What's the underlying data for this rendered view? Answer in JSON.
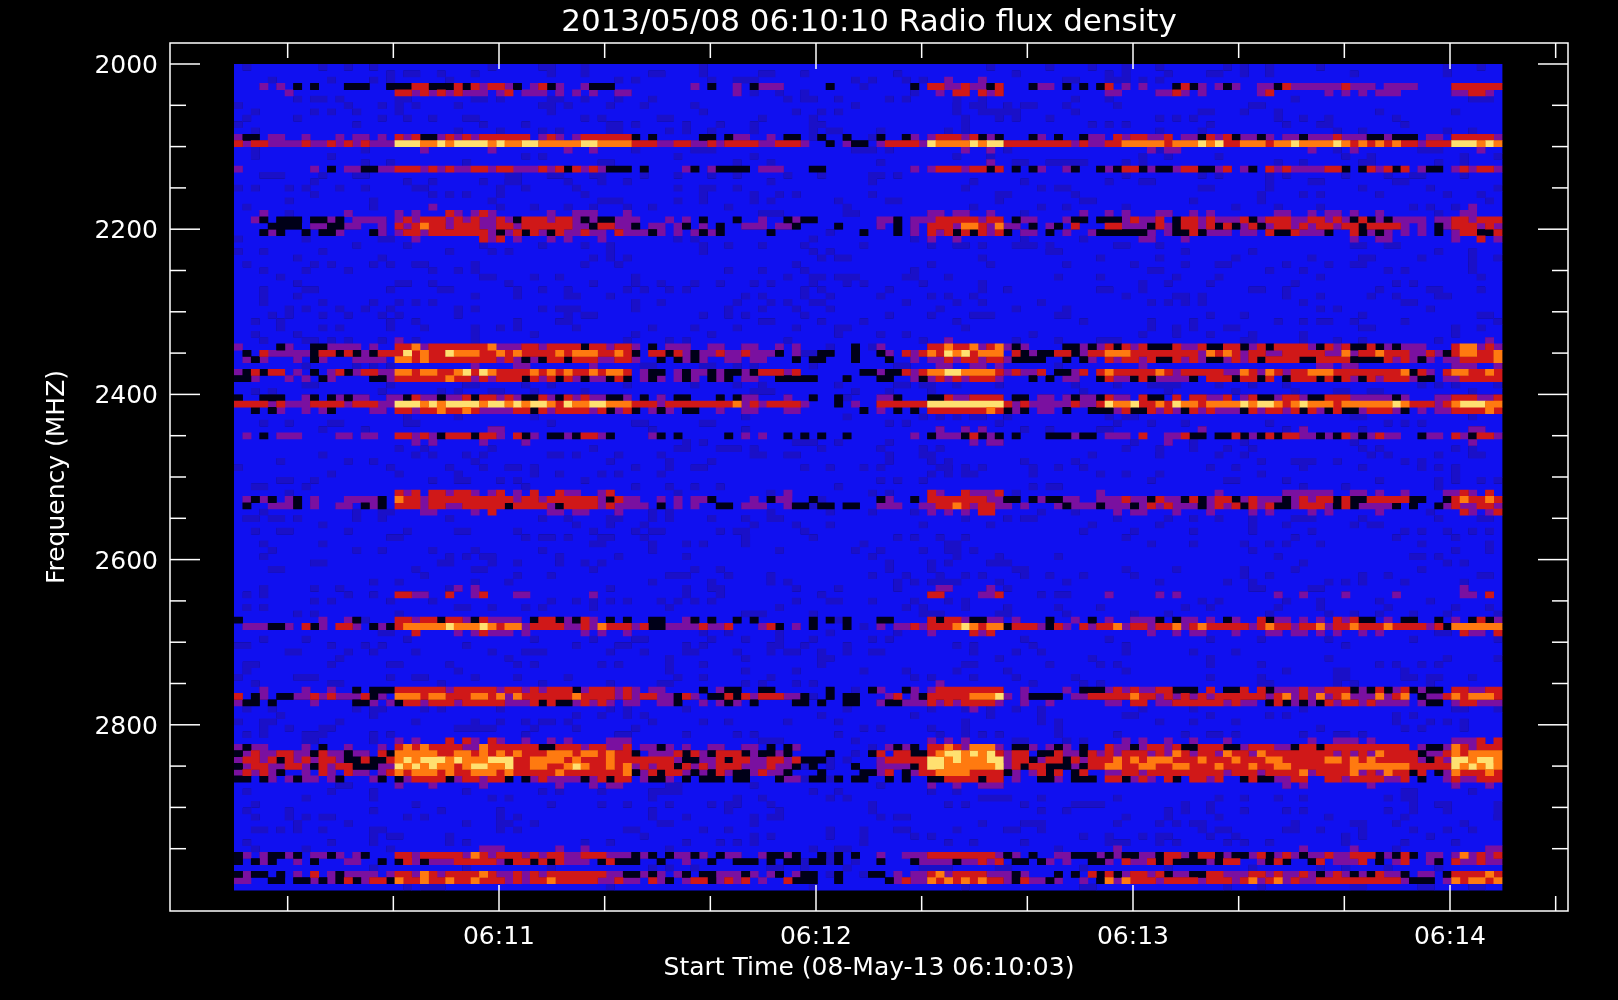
{
  "title": "2013/05/08 06:10:10 Radio flux density",
  "y_axis": {
    "label": "Frequency (MHZ)",
    "ticks": [
      "2000",
      "2200",
      "2400",
      "2600",
      "2800"
    ]
  },
  "x_axis": {
    "label": "Start Time (08-May-13 06:10:03)",
    "ticks": [
      "06:11",
      "06:12",
      "06:13",
      "06:14"
    ]
  }
}
